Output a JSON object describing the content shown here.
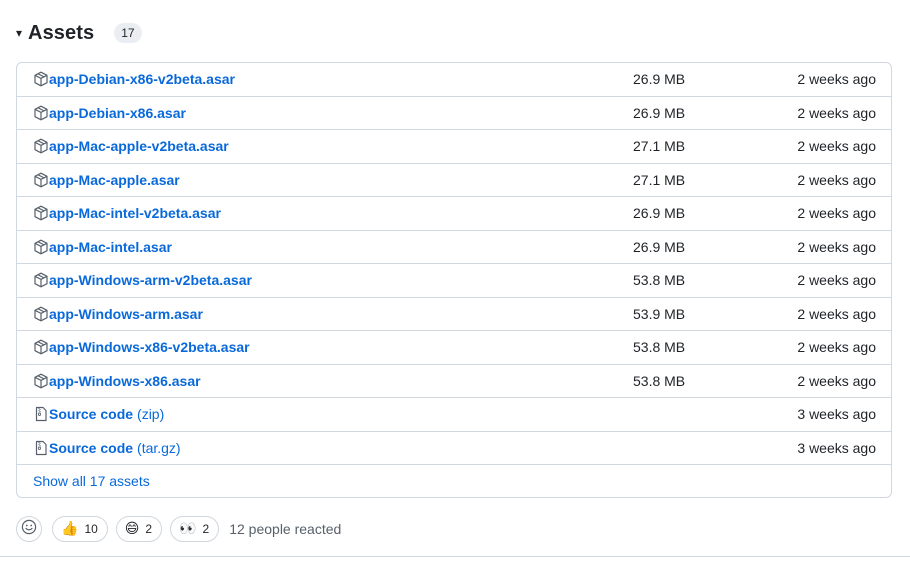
{
  "assets": {
    "caret": "▾",
    "title": "Assets",
    "count": "17",
    "items": [
      {
        "name": "app-Debian-x86-v2beta.asar",
        "size": "26.9 MB",
        "time": "2 weeks ago",
        "icon": "package-icon"
      },
      {
        "name": "app-Debian-x86.asar",
        "size": "26.9 MB",
        "time": "2 weeks ago",
        "icon": "package-icon"
      },
      {
        "name": "app-Mac-apple-v2beta.asar",
        "size": "27.1 MB",
        "time": "2 weeks ago",
        "icon": "package-icon"
      },
      {
        "name": "app-Mac-apple.asar",
        "size": "27.1 MB",
        "time": "2 weeks ago",
        "icon": "package-icon"
      },
      {
        "name": "app-Mac-intel-v2beta.asar",
        "size": "26.9 MB",
        "time": "2 weeks ago",
        "icon": "package-icon"
      },
      {
        "name": "app-Mac-intel.asar",
        "size": "26.9 MB",
        "time": "2 weeks ago",
        "icon": "package-icon"
      },
      {
        "name": "app-Windows-arm-v2beta.asar",
        "size": "53.8 MB",
        "time": "2 weeks ago",
        "icon": "package-icon"
      },
      {
        "name": "app-Windows-arm.asar",
        "size": "53.9 MB",
        "time": "2 weeks ago",
        "icon": "package-icon"
      },
      {
        "name": "app-Windows-x86-v2beta.asar",
        "size": "53.8 MB",
        "time": "2 weeks ago",
        "icon": "package-icon"
      },
      {
        "name": "app-Windows-x86.asar",
        "size": "53.8 MB",
        "time": "2 weeks ago",
        "icon": "package-icon"
      }
    ],
    "source": [
      {
        "name": "Source code",
        "suffix": "(zip)",
        "time": "3 weeks ago",
        "icon": "file-zip-icon"
      },
      {
        "name": "Source code",
        "suffix": "(tar.gz)",
        "time": "3 weeks ago",
        "icon": "file-zip-icon"
      }
    ],
    "show_all": "Show all 17 assets"
  },
  "reactions": {
    "items": [
      {
        "emoji": "👍",
        "count": "10"
      },
      {
        "emoji": "😄",
        "count": "2"
      },
      {
        "emoji": "👀",
        "count": "2"
      }
    ],
    "summary": "12 people reacted"
  },
  "colors": {
    "link": "#0969da",
    "border": "#d0d7de",
    "text": "#1f2328"
  }
}
